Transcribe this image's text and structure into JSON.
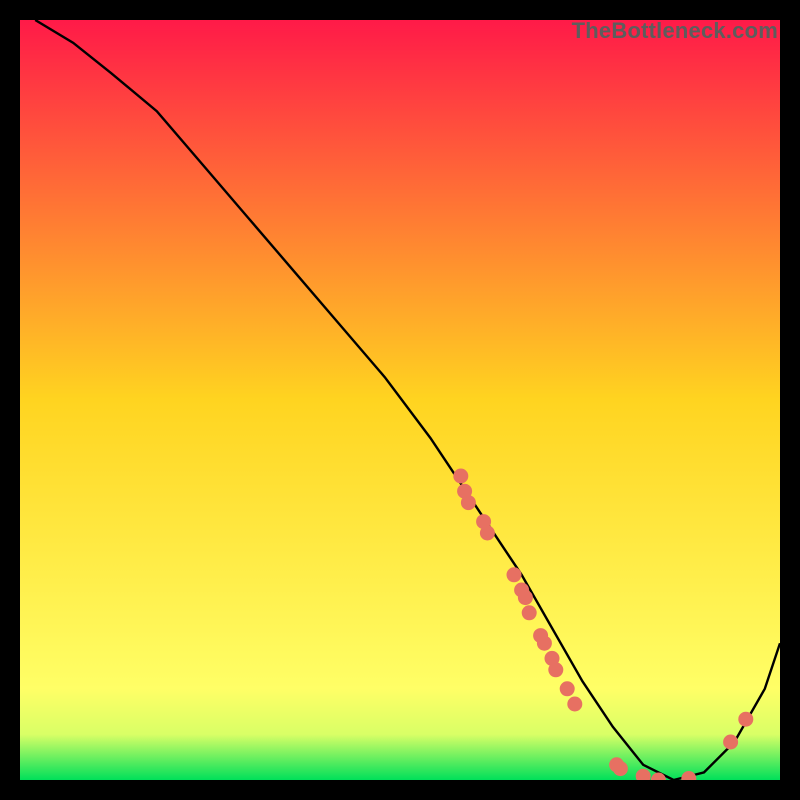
{
  "watermark": "TheBottleneck.com",
  "chart_data": {
    "type": "line",
    "title": "",
    "xlabel": "",
    "ylabel": "",
    "xlim": [
      0,
      100
    ],
    "ylim": [
      0,
      100
    ],
    "background_gradient": {
      "stops": [
        {
          "pos": 0,
          "color": "#ff1a48"
        },
        {
          "pos": 50,
          "color": "#ffd420"
        },
        {
          "pos": 88,
          "color": "#ffff66"
        },
        {
          "pos": 94,
          "color": "#d9ff66"
        },
        {
          "pos": 100,
          "color": "#00e05a"
        }
      ]
    },
    "series": [
      {
        "name": "bottleneck-curve",
        "x": [
          2,
          7,
          12,
          18,
          24,
          30,
          36,
          42,
          48,
          54,
          58,
          62,
          66,
          70,
          74,
          78,
          82,
          86,
          90,
          94,
          98,
          100
        ],
        "y": [
          100,
          97,
          93,
          88,
          81,
          74,
          67,
          60,
          53,
          45,
          39,
          33,
          27,
          20,
          13,
          7,
          2,
          0,
          1,
          5,
          12,
          18
        ],
        "color": "#000000"
      }
    ],
    "markers": {
      "name": "highlighted-points",
      "color": "#e77062",
      "points": [
        {
          "x": 58,
          "y": 40
        },
        {
          "x": 58.5,
          "y": 38
        },
        {
          "x": 59,
          "y": 36.5
        },
        {
          "x": 61,
          "y": 34
        },
        {
          "x": 61.5,
          "y": 32.5
        },
        {
          "x": 65,
          "y": 27
        },
        {
          "x": 66,
          "y": 25
        },
        {
          "x": 66.5,
          "y": 24
        },
        {
          "x": 67,
          "y": 22
        },
        {
          "x": 68.5,
          "y": 19
        },
        {
          "x": 69,
          "y": 18
        },
        {
          "x": 70,
          "y": 16
        },
        {
          "x": 70.5,
          "y": 14.5
        },
        {
          "x": 72,
          "y": 12
        },
        {
          "x": 73,
          "y": 10
        },
        {
          "x": 78.5,
          "y": 2
        },
        {
          "x": 79,
          "y": 1.5
        },
        {
          "x": 82,
          "y": 0.5
        },
        {
          "x": 84,
          "y": 0
        },
        {
          "x": 88,
          "y": 0.2
        },
        {
          "x": 93.5,
          "y": 5
        },
        {
          "x": 95.5,
          "y": 8
        }
      ]
    }
  }
}
